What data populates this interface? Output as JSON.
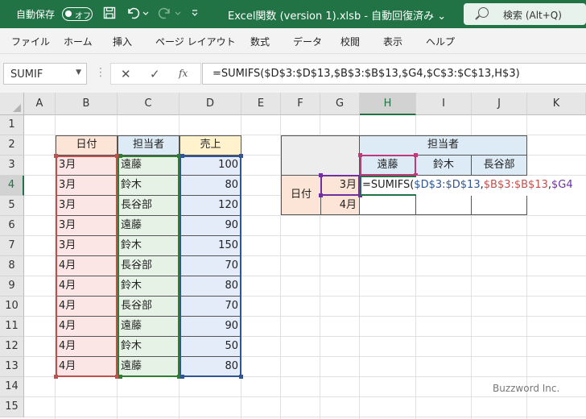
{
  "titlebar": {
    "autosave_label": "自動保存",
    "autosave_state": "オフ",
    "save_icon": "save-icon",
    "undo_icon": "undo-icon",
    "redo_icon": "redo-icon",
    "customize_icon": "customize-qat-icon",
    "title": "Excel関数 (version 1).xlsb  -  自動回復済み  ⌄",
    "search_text": "検索 (Alt+Q)",
    "color": "#217346"
  },
  "ribbon": {
    "tabs": [
      "ファイル",
      "ホーム",
      "挿入",
      "ページ レイアウト",
      "数式",
      "データ",
      "校閲",
      "表示",
      "ヘルプ"
    ]
  },
  "formula_bar": {
    "name_box": "SUMIF",
    "cancel": "✕",
    "enter": "✓",
    "fx": "fx",
    "formula": "=SUMIFS($D$3:$D$13,$B$3:$B$13,$G4,$C$3:$C$13,H$3)"
  },
  "grid": {
    "columns": [
      "A",
      "B",
      "C",
      "D",
      "E",
      "F",
      "G",
      "H",
      "I",
      "J",
      "K"
    ],
    "rows": [
      "1",
      "2",
      "3",
      "4",
      "5",
      "6",
      "7",
      "8",
      "9",
      "10",
      "11",
      "12",
      "13",
      "14",
      "15"
    ],
    "selected_column": "H",
    "selected_row": "4"
  },
  "table1": {
    "headers": [
      "日付",
      "担当者",
      "売上"
    ],
    "header_colors": [
      "#fce4d6",
      "#ddebf7",
      "#fff2cc"
    ],
    "rows": [
      [
        "3月",
        "遠藤",
        "100"
      ],
      [
        "3月",
        "鈴木",
        "80"
      ],
      [
        "3月",
        "長谷部",
        "120"
      ],
      [
        "3月",
        "遠藤",
        "90"
      ],
      [
        "3月",
        "鈴木",
        "150"
      ],
      [
        "4月",
        "長谷部",
        "70"
      ],
      [
        "4月",
        "鈴木",
        "80"
      ],
      [
        "4月",
        "長谷部",
        "70"
      ],
      [
        "4月",
        "遠藤",
        "90"
      ],
      [
        "4月",
        "鈴木",
        "50"
      ],
      [
        "4月",
        "遠藤",
        "80"
      ]
    ]
  },
  "table2": {
    "top_header": "担当者",
    "side_header": "日付",
    "col_headers": [
      "遠藤",
      "鈴木",
      "長谷部"
    ],
    "row_headers": [
      "3月",
      "4月"
    ],
    "editing_formula_prefix": "=SUMIFS(",
    "editing_arg1": "$D$3:$D$13",
    "editing_arg2": "$B$3:$B$13",
    "editing_arg3": "$G4",
    "sep": ","
  },
  "colors": {
    "ref_red": "#c0504d",
    "ref_green": "#2e7d32",
    "ref_blue": "#2f5597",
    "ref_purple": "#7030a0",
    "ref_pink": "#c0397a"
  },
  "watermark": "Buzzword Inc."
}
